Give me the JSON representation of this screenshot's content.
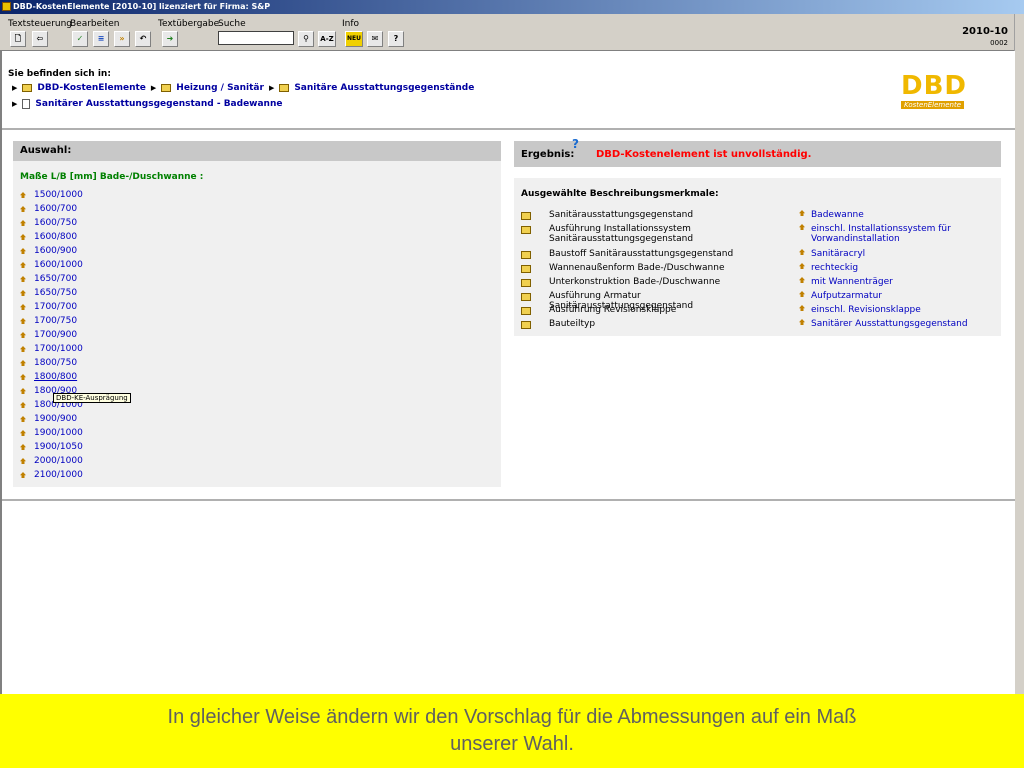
{
  "window_title": "DBD-KostenElemente [2010-10] lizenziert für Firma: S&P",
  "toolbar": {
    "groups": [
      "Textsteuerung",
      "Bearbeiten",
      "Textübergabe",
      "Suche",
      "Info"
    ],
    "version": "2010-10",
    "version_sub": "0002",
    "search_value": "",
    "az_label": "A-Z",
    "new_label": "NEU"
  },
  "breadcrumb": {
    "label": "Sie befinden sich in:",
    "items": [
      "DBD-KostenElemente",
      "Heizung / Sanitär",
      "Sanitäre Ausstattungsgegenstände"
    ],
    "current": "Sanitärer Ausstattungsgegenstand - Badewanne"
  },
  "logo": {
    "main": "DBD",
    "sub": "KostenElemente"
  },
  "auswahl": {
    "title": "Auswahl:",
    "subtitle": "Maße L/B [mm] Bade-/Duschwanne :",
    "items": [
      "1500/1000",
      "1600/700",
      "1600/750",
      "1600/800",
      "1600/900",
      "1600/1000",
      "1650/700",
      "1650/750",
      "1700/700",
      "1700/750",
      "1700/900",
      "1700/1000",
      "1800/750",
      "1800/800",
      "1800/900",
      "1800/1000",
      "1900/900",
      "1900/1000",
      "1900/1050",
      "2000/1000",
      "2100/1000"
    ],
    "tooltip": "DBD-KE-Ausprägung"
  },
  "ergebnis": {
    "title": "Ergebnis:",
    "help": "?",
    "status": "DBD-Kostenelement ist unvollständig.",
    "merkmale_title": "Ausgewählte Beschreibungsmerkmale:",
    "rows": [
      {
        "name": "Sanitärausstattungsgegenstand",
        "value": "Badewanne"
      },
      {
        "name": "Ausführung Installationssystem Sanitärausstattungsgegenstand",
        "value": "einschl. Installationssystem für Vorwandinstallation"
      },
      {
        "name": "Baustoff Sanitärausstattungsgegenstand",
        "value": "Sanitäracryl"
      },
      {
        "name": "Wannenaußenform Bade-/Duschwanne",
        "value": "rechteckig"
      },
      {
        "name": "Unterkonstruktion Bade-/Duschwanne",
        "value": "mit Wannenträger"
      },
      {
        "name": "Ausführung Armatur Sanitärausstattungsgegenstand",
        "value": "Aufputzarmatur"
      },
      {
        "name": "Ausführung Revisionsklappe",
        "value": "einschl. Revisionsklappe"
      },
      {
        "name": "Bauteiltyp",
        "value": "Sanitärer Ausstattungsgegenstand"
      }
    ]
  },
  "caption": {
    "line1": "In gleicher Weise ändern wir den Vorschlag für die Abmessungen auf ein Maß",
    "line2": "unserer Wahl."
  }
}
